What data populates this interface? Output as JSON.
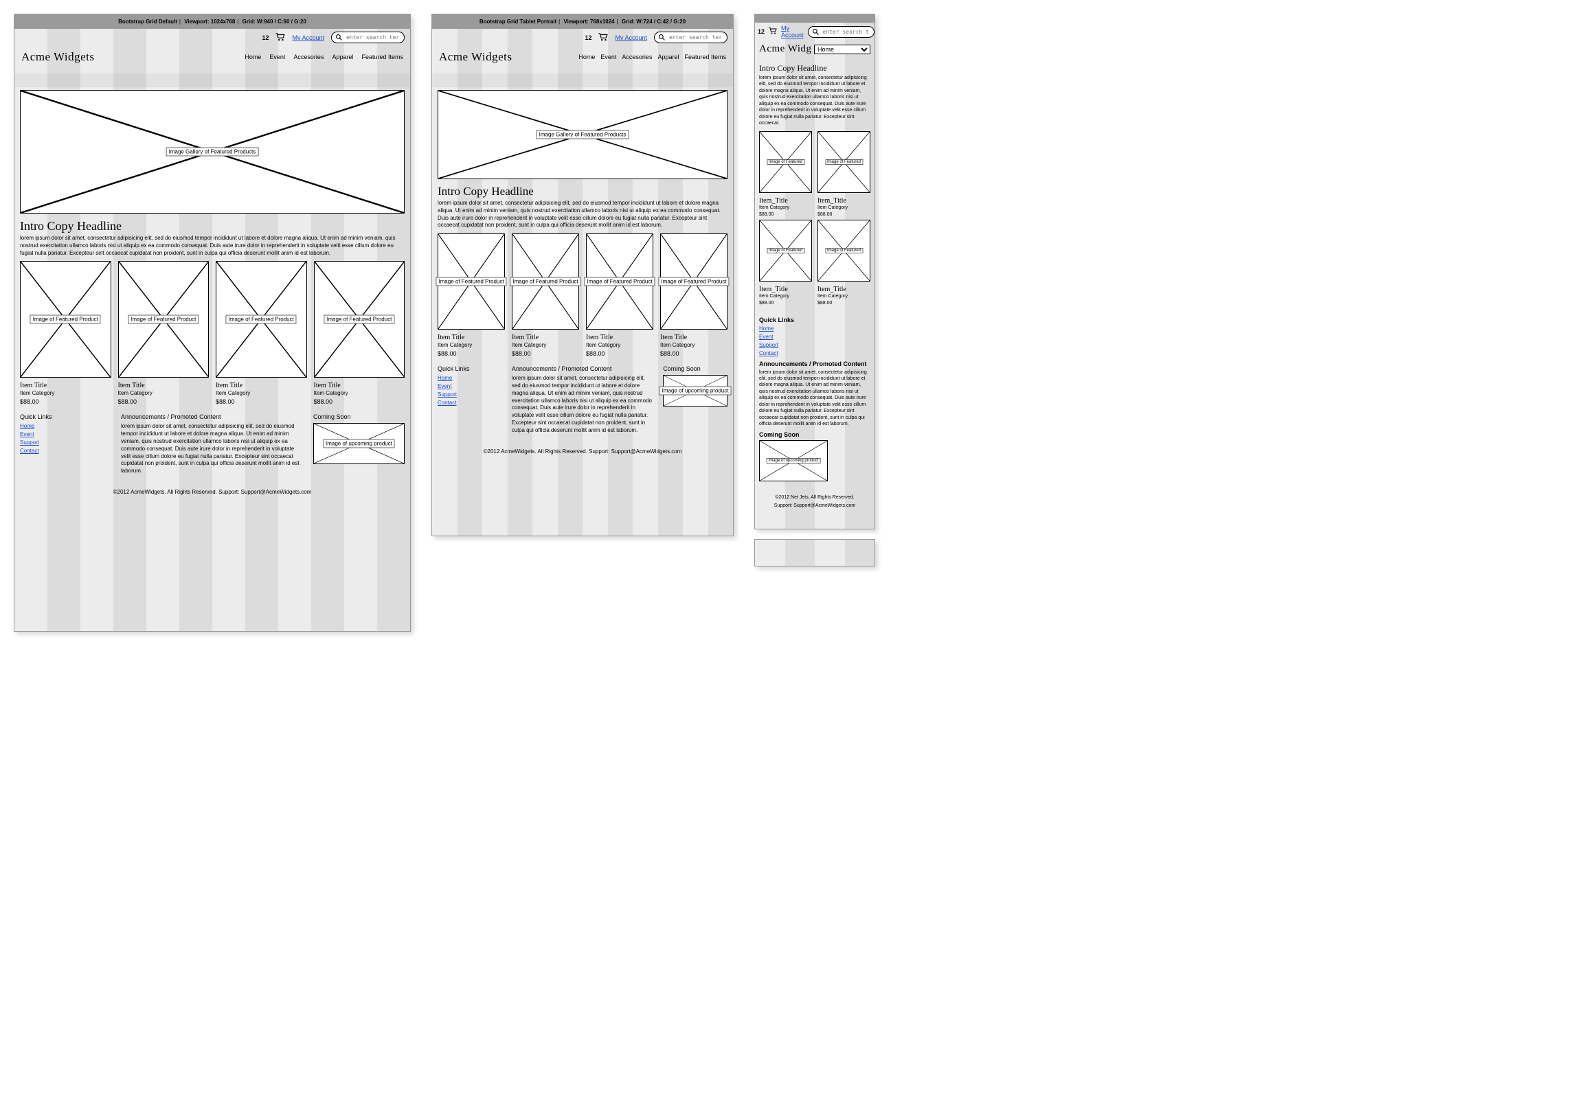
{
  "viewports": {
    "default": {
      "title": "Bootstrap Grid Default",
      "viewport": "1024x768",
      "grid": "W:940 / C:60 / G:20"
    },
    "tablet": {
      "title": "Bootstrap Grid Tablet Portrait",
      "viewport": "768x1024",
      "grid": "W:724 / C:42 / G:20"
    },
    "mobile": {
      "title": "",
      "viewport": "",
      "grid": ""
    }
  },
  "util": {
    "cart_count": "12",
    "my_account": "My Account",
    "search_placeholder": "enter search terms"
  },
  "brand": "Acme Widgets",
  "brand_mobile": "Acme Widg",
  "nav": {
    "items": [
      "Home",
      "Event",
      "Accesories",
      "Apparel",
      "Featured Items"
    ],
    "mobile_selected": "Home"
  },
  "hero_label": "Image Gallery of Featured Products",
  "intro": {
    "headline": "Intro Copy Headline",
    "body_default": "lorem ipsum dolor sit amet, consectetur adipisicing elit, sed do eiusmod tempor incididunt ut labore et dolore magna aliqua. Ut enim ad minim veniam, quis nostrud exercitation ullamco laboris nisi ut aliquip ex ea commodo consequat. Duis aute irure dolor in reprehenderit in voluptate velit esse cillum dolore eu fugiat nulla pariatur. Excepteur sint occaecat cupidatat non proident, sunt in culpa qui officia deserunt mollit anim id est laborum.",
    "body_tablet": "lorem ipsum dolor sit amet, consectetur adipisicing elit, sed do eiusmod tempor incididunt ut labore et dolore magna aliqua. Ut enim ad minim veniam, quis nostrud exercitation ullamco laboris nisi ut aliquip ex ea commodo consequat. Duis aute irure dolor in reprehenderit in voluptate velit esse cillum dolore eu fugiat nulla pariatur. Excepteur sint occaecat cupidatat non proident, sunt in culpa qui officia deserunt mollit anim id est laborum.",
    "body_mobile": "lorem ipsum dolor sit amet, consectetur adipisicing elit, sed do eiusmod tempor incididunt ut labore et dolore magna aliqua. Ut enim ad minim veniam, quis nostrud exercitation ullamco laboris nisi ut aliquip ex ea commodo consequat. Duis aute irure dolor in reprehenderit in voluptate velit esse cillum dolore eu fugiat nulla pariatur. Excepteur sint occaecat."
  },
  "product": {
    "img_label": "Image of Featured Product",
    "img_label_short": "Image of Featured",
    "title": "Item Title",
    "title_u": "Item_Title",
    "category": "Item Category",
    "price": "$88.00"
  },
  "quick_links": {
    "heading": "Quick Links",
    "items": [
      "Home",
      "Event",
      "Support",
      "Contact"
    ]
  },
  "promo": {
    "heading": "Announcements / Promoted Content",
    "body": "lorem ipsum dolor sit amet, consectetur adipisicing elit, sed do eiusmod tempor incididunt ut labore et dolore magna aliqua. Ut enim ad minim veniam, quis nostrud exercitation ullamco laboris nisi ut aliquip ex ea commodo consequat. Duis aute irure dolor in reprehenderit in voluptate velit esse cillum dolore eu fugiat nulla pariatur. Excepteur sint occaecat cupidatat non proident, sunt in culpa qui officia deserunt mollit anim id est laborum."
  },
  "coming": {
    "heading": "Coming Soon",
    "img_label": "Image of upcoming product"
  },
  "footer": {
    "default": "©2012 AcmeWidgets.   All Rights Reserved.   Support: Support@AcmeWidgets.com",
    "mobile_l1": "©2012 Net Jets.   All Rights Reserved.",
    "mobile_l2": "Support: Support@AcmeWidgets.com"
  },
  "labels": {
    "viewport_prefix": "Viewport:",
    "grid_prefix": "Grid:"
  }
}
